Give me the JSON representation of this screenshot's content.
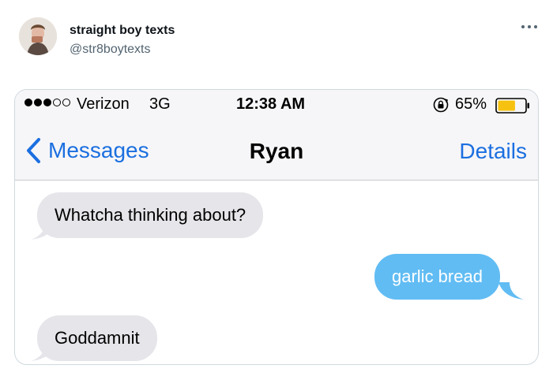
{
  "tweet": {
    "author_name": "straight boy texts",
    "author_handle": "@str8boytexts",
    "more_icon": "more-horizontal-icon"
  },
  "ios": {
    "status": {
      "carrier": "Verizon",
      "network": "3G",
      "time": "12:38 AM",
      "battery": "65%",
      "battery_level": 0.65,
      "signal_bars_filled": 3,
      "signal_bars_total": 5
    },
    "nav": {
      "back_label": "Messages",
      "title": "Ryan",
      "details_label": "Details"
    },
    "messages": [
      {
        "direction": "incoming",
        "text": "Whatcha thinking about?"
      },
      {
        "direction": "outgoing",
        "text": "garlic bread"
      },
      {
        "direction": "incoming",
        "text": "Goddamnit"
      }
    ]
  },
  "colors": {
    "ios_blue": "#1b6fe0",
    "outgoing_bubble": "#61bcf3",
    "incoming_bubble": "#e5e5ea",
    "battery_fill": "#f6c20f"
  }
}
